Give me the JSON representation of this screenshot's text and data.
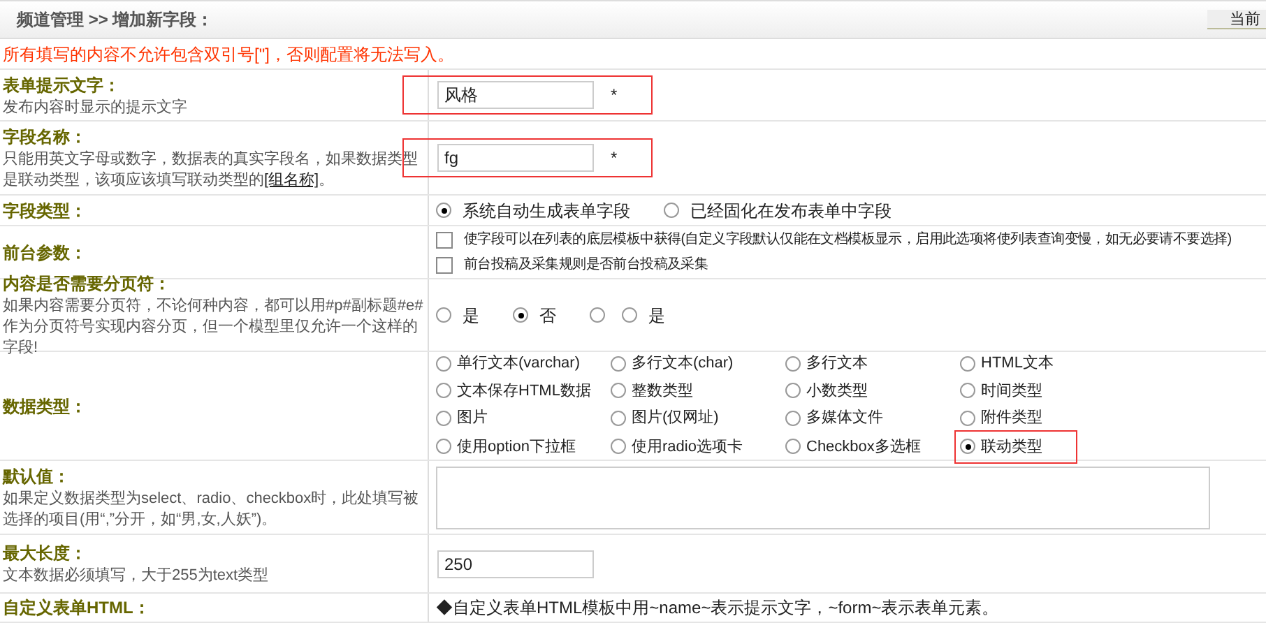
{
  "header": {
    "breadcrumb": "频道管理 >> 增加新字段：",
    "button": "当前"
  },
  "warning": "所有填写的内容不允许包含双引号[\"]，否则配置将无法写入。",
  "rows": [
    {
      "kind": "input",
      "label": "表单提示文字：",
      "desc": "发布内容时显示的提示文字",
      "value": "风格",
      "required": "*",
      "highlighted": true
    },
    {
      "kind": "input",
      "label": "字段名称：",
      "desc": "只能用英文字母或数字，数据表的真实字段名，如果数据类型是联动类型，该项应该填写联动类型的",
      "link": "[组名称]",
      "desc_end": "。",
      "value": "fg",
      "required": "*",
      "highlighted": true
    },
    {
      "kind": "radios",
      "label": "字段类型：",
      "options": [
        {
          "label": "系统自动生成表单字段",
          "selected": true
        },
        {
          "label": "已经固化在发布表单中字段",
          "selected": false
        }
      ]
    },
    {
      "kind": "checks",
      "label": "前台参数：",
      "options": [
        {
          "label": "使字段可以在列表的底层模板中获得(自定义字段默认仅能在文档模板显示，启用此选项将使列表查询变慢，如无必要请不要选择)",
          "checked": false
        },
        {
          "label": "前台投稿及采集规则是否前台投稿及采集",
          "checked": false
        }
      ]
    },
    {
      "kind": "radios",
      "label": "内容是否需要分页符：",
      "desc": "如果内容需要分页符，不论何种内容，都可以用#p#副标题#e#作为分页符号实现内容分页，但一个模型里仅允许一个这样的字段!",
      "options": [
        {
          "label": "是",
          "selected": false
        },
        {
          "label": "否",
          "selected": true
        },
        {
          "selected": false
        },
        {
          "label": "是",
          "selected": false
        }
      ]
    },
    {
      "kind": "grid",
      "label": "数据类型：",
      "options": [
        {
          "label": "单行文本(varchar)",
          "selected": false,
          "highlighted": false
        },
        {
          "label": "多行文本(char)",
          "selected": false,
          "highlighted": false
        },
        {
          "label": "多行文本",
          "selected": false,
          "highlighted": false
        },
        {
          "label": "HTML文本",
          "selected": false,
          "highlighted": false
        },
        {
          "label": "文本保存HTML数据",
          "selected": false,
          "highlighted": false
        },
        {
          "label": "整数类型",
          "selected": false,
          "highlighted": false
        },
        {
          "label": "小数类型",
          "selected": false,
          "highlighted": false
        },
        {
          "label": "时间类型",
          "selected": false,
          "highlighted": false
        },
        {
          "label": "图片",
          "selected": false,
          "highlighted": false
        },
        {
          "label": "图片(仅网址)",
          "selected": false,
          "highlighted": false
        },
        {
          "label": "多媒体文件",
          "selected": false,
          "highlighted": false
        },
        {
          "label": "附件类型",
          "selected": false,
          "highlighted": false
        },
        {
          "label": "使用option下拉框",
          "selected": false,
          "highlighted": false
        },
        {
          "label": "使用radio选项卡",
          "selected": false,
          "highlighted": false
        },
        {
          "label": "Checkbox多选框",
          "selected": false,
          "highlighted": false
        },
        {
          "label": "联动类型",
          "selected": true,
          "highlighted": true
        }
      ]
    },
    {
      "kind": "textarea",
      "label": "默认值：",
      "desc": "如果定义数据类型为select、radio、checkbox时，此处填写被选择的项目(用“,”分开，如“男,女,人妖”)。"
    },
    {
      "kind": "input",
      "label": "最大长度：",
      "desc": "文本数据必须填写，大于255为text类型",
      "value": "250",
      "highlighted": false
    },
    {
      "kind": "note",
      "label": "自定义表单HTML：",
      "note": "◆自定义表单HTML模板中用~name~表示提示文字，~form~表示表单元素。"
    }
  ]
}
